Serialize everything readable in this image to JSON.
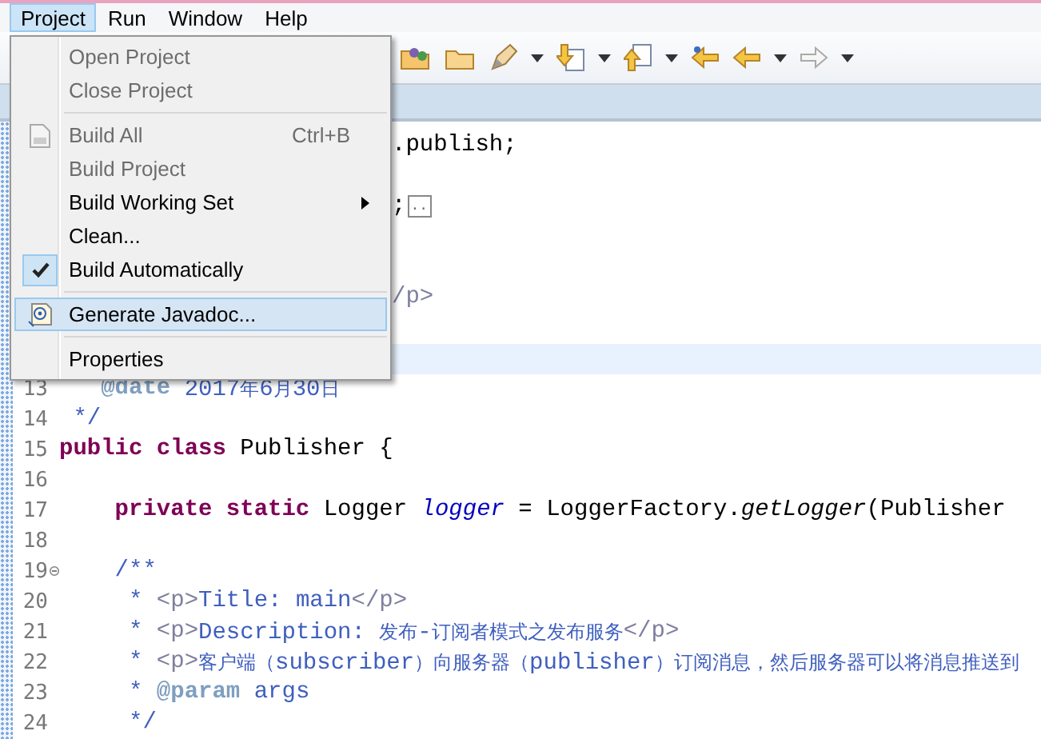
{
  "menubar": [
    {
      "label": "Project",
      "selected": true
    },
    {
      "label": "Run",
      "selected": false
    },
    {
      "label": "Window",
      "selected": false
    },
    {
      "label": "Help",
      "selected": false
    }
  ],
  "menu": [
    {
      "kind": "item",
      "label": "Open Project",
      "disabled": true,
      "checked": false,
      "submenu": false,
      "selected": false
    },
    {
      "kind": "item",
      "label": "Close Project",
      "disabled": true,
      "checked": false,
      "submenu": false,
      "selected": false
    },
    {
      "kind": "separator"
    },
    {
      "kind": "item",
      "label": "Build All",
      "shortcut": "Ctrl+B",
      "disabled": true,
      "checked": false,
      "submenu": false,
      "selected": false
    },
    {
      "kind": "item",
      "label": "Build Project",
      "disabled": true,
      "checked": false,
      "submenu": false,
      "selected": false
    },
    {
      "kind": "item",
      "label": "Build Working Set",
      "submenu": true,
      "disabled": false,
      "checked": false,
      "selected": false
    },
    {
      "kind": "item",
      "label": "Clean...",
      "disabled": false,
      "checked": false,
      "submenu": false,
      "selected": false
    },
    {
      "kind": "item",
      "label": "Build Automatically",
      "disabled": false,
      "checked": true,
      "submenu": false,
      "selected": false
    },
    {
      "kind": "separator"
    },
    {
      "kind": "item",
      "label": "Generate Javadoc...",
      "disabled": false,
      "checked": false,
      "submenu": false,
      "selected": true
    },
    {
      "kind": "separator"
    },
    {
      "kind": "item",
      "label": "Properties",
      "disabled": false,
      "checked": false,
      "submenu": false,
      "selected": false
    }
  ],
  "editor": {
    "lines": [
      {
        "kind": "covered",
        "current": false,
        "segments": [
          {
            "kind": "plain",
            "text": ".publish;"
          }
        ]
      },
      {
        "kind": "covered",
        "current": false
      },
      {
        "kind": "covered",
        "current": false,
        "segments": [
          {
            "kind": "plain",
            "text": ";"
          },
          {
            "kind": "fold-marker",
            "text": ".."
          }
        ]
      },
      {
        "kind": "covered",
        "current": false
      },
      {
        "kind": "covered",
        "current": false
      },
      {
        "kind": "covered",
        "current": false,
        "segments": [
          {
            "kind": "tag",
            "text": "/p>"
          }
        ]
      },
      {
        "kind": "covered",
        "current": false
      },
      {
        "kind": "covered",
        "current": true
      },
      {
        "kind": "line",
        "number": "13",
        "current": false,
        "segments": [
          {
            "kind": "doctag",
            "text": "   @date"
          },
          {
            "kind": "comment",
            "text": " 2017年6月30日"
          }
        ]
      },
      {
        "kind": "line",
        "number": "14",
        "current": false,
        "segments": [
          {
            "kind": "comment",
            "text": " */"
          }
        ]
      },
      {
        "kind": "line",
        "number": "15",
        "current": false,
        "segments": [
          {
            "kind": "keyword",
            "text": "public"
          },
          {
            "kind": "keyword",
            "text": " class"
          },
          {
            "kind": "plain",
            "text": " Publisher {"
          }
        ]
      },
      {
        "kind": "line",
        "number": "16",
        "current": false
      },
      {
        "kind": "line",
        "number": "17",
        "current": false,
        "segments": [
          {
            "kind": "keyword",
            "text": "    private"
          },
          {
            "kind": "keyword",
            "text": " static"
          },
          {
            "kind": "plain",
            "text": " Logger "
          },
          {
            "kind": "field",
            "text": "logger"
          },
          {
            "kind": "plain",
            "text": " = LoggerFactory."
          },
          {
            "kind": "method",
            "text": "getLogger"
          },
          {
            "kind": "plain",
            "text": "(Publisher"
          }
        ]
      },
      {
        "kind": "line",
        "number": "18",
        "current": false
      },
      {
        "kind": "line",
        "number": "19",
        "current": false,
        "expanded": true,
        "segments": [
          {
            "kind": "comment",
            "text": "    /**"
          }
        ]
      },
      {
        "kind": "line",
        "number": "20",
        "current": false,
        "segments": [
          {
            "kind": "comment",
            "text": "     * "
          },
          {
            "kind": "tag",
            "text": "<p>"
          },
          {
            "kind": "comment",
            "text": "Title: main"
          },
          {
            "kind": "tag",
            "text": "</p>"
          }
        ]
      },
      {
        "kind": "line",
        "number": "21",
        "current": false,
        "segments": [
          {
            "kind": "comment",
            "text": "     * "
          },
          {
            "kind": "tag",
            "text": "<p>"
          },
          {
            "kind": "comment",
            "text": "Description: 发布-订阅者模式之发布服务"
          },
          {
            "kind": "tag",
            "text": "</p>"
          }
        ]
      },
      {
        "kind": "line",
        "number": "22",
        "current": false,
        "segments": [
          {
            "kind": "comment",
            "text": "     * "
          },
          {
            "kind": "tag",
            "text": "<p>"
          },
          {
            "kind": "comment",
            "text": "客户端（subscriber）向服务器（publisher）订阅消息，然后服务器可以将消息推送到"
          }
        ]
      },
      {
        "kind": "line",
        "number": "23",
        "current": false,
        "segments": [
          {
            "kind": "comment",
            "text": "     * "
          },
          {
            "kind": "doctag",
            "text": "@param"
          },
          {
            "kind": "comment",
            "text": " args"
          }
        ]
      },
      {
        "kind": "line",
        "number": "24",
        "current": false,
        "segments": [
          {
            "kind": "comment",
            "text": "     */"
          }
        ]
      }
    ]
  }
}
